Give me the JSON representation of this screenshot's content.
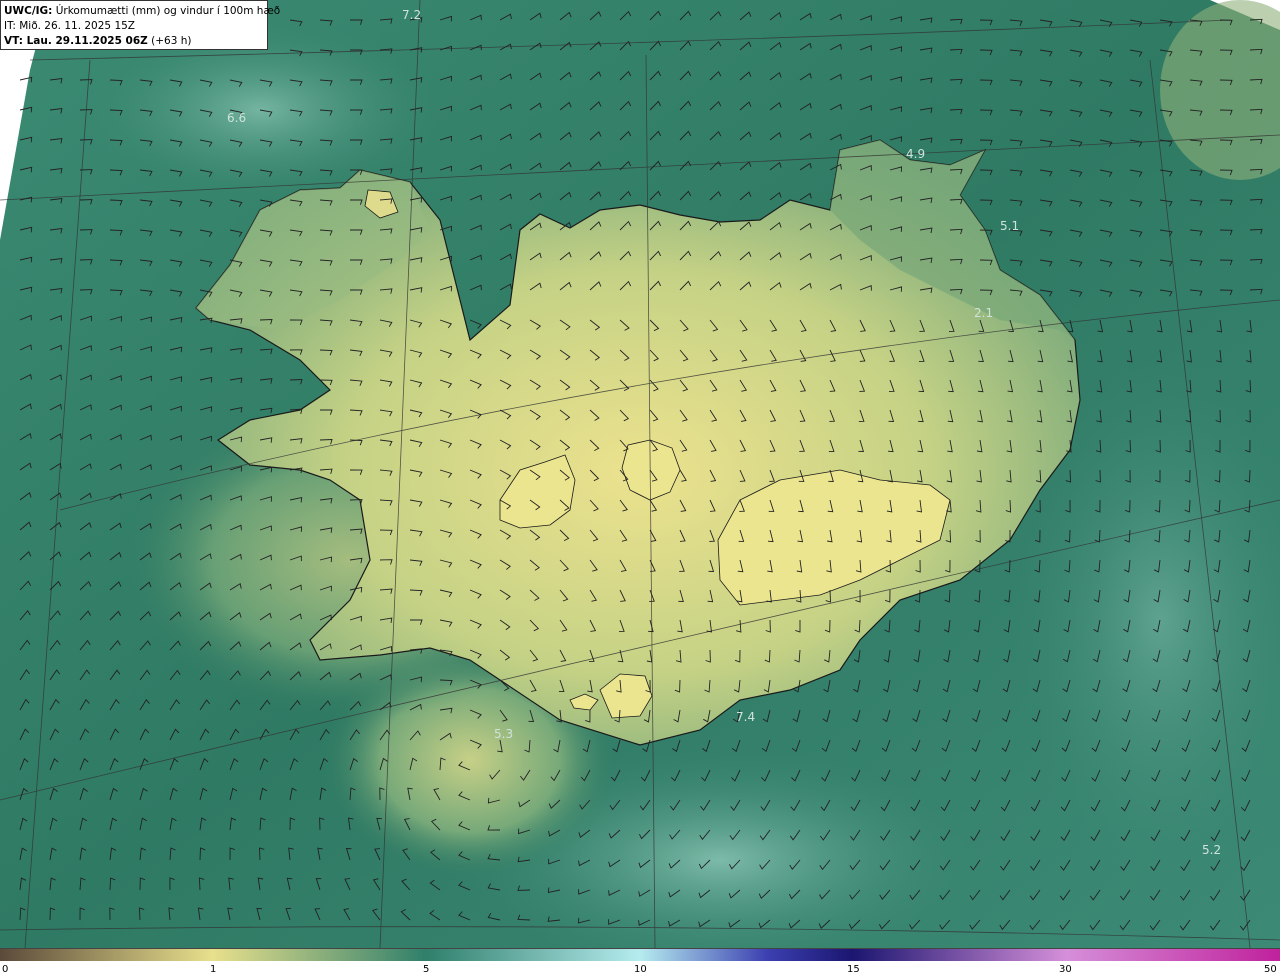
{
  "header": {
    "product": "UWC/IG:",
    "description": "Úrkomumætti (mm) og vindur í 100m hæð",
    "init_time": "IT: Mið. 26. 11. 2025 15Z",
    "valid_time": "VT: Lau. 29.11.2025 06Z",
    "lead": "(+63 h)"
  },
  "value_labels": [
    {
      "text": "7.2"
    },
    {
      "text": "6.6"
    },
    {
      "text": "4.9"
    },
    {
      "text": "5.1"
    },
    {
      "text": "2.1"
    },
    {
      "text": "5.3"
    },
    {
      "text": "7.4"
    },
    {
      "text": "5.2"
    }
  ],
  "colorbar": {
    "ticks": [
      "0",
      "1",
      "5",
      "10",
      "15",
      "30",
      "50"
    ],
    "colors": {
      "c0": "#5b4a3a",
      "c1": "#e8e08c",
      "c5": "#2f7f6b",
      "c10": "#b6ecef",
      "c15": "#1b1670",
      "c30": "#d58fd9",
      "c50": "#c0219c"
    }
  },
  "palette": {
    "ocean": "#2d7a66",
    "ocean_light": "#4c9c88",
    "land_low": "#a7c27a",
    "land_high": "#e9e28c",
    "coast": "#1a1a1a",
    "grid": "#3a3a3a"
  }
}
